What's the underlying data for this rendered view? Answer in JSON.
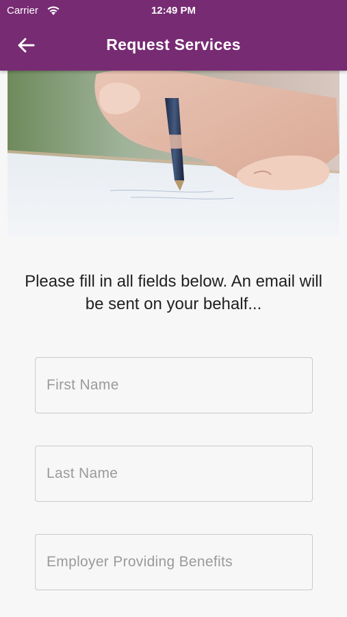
{
  "status_bar": {
    "carrier": "Carrier",
    "time": "12:49 PM"
  },
  "app_bar": {
    "title": "Request Services",
    "back_icon": "arrow-left-icon",
    "background_color": "#772b73"
  },
  "hero_image": {
    "icon": "hand-writing-with-pen-photo"
  },
  "instructions": "Please fill in all fields below. An email will be sent on your behalf...",
  "form": {
    "fields": [
      {
        "placeholder": "First Name",
        "value": ""
      },
      {
        "placeholder": "Last Name",
        "value": ""
      },
      {
        "placeholder": "Employer Providing Benefits",
        "value": ""
      }
    ]
  }
}
